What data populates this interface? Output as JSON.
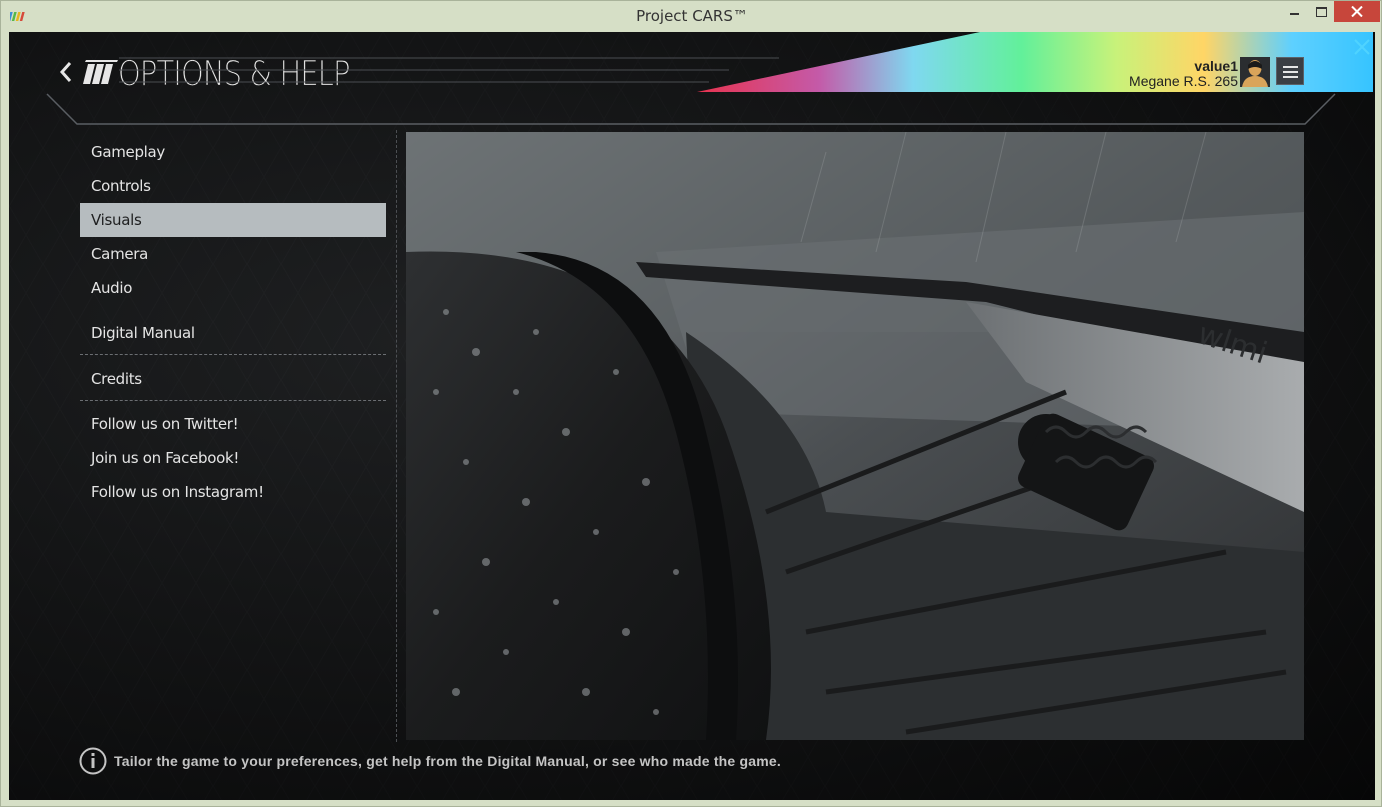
{
  "window": {
    "title": "Project CARS™"
  },
  "header": {
    "title": "OPTIONS & HELP",
    "profile_name": "value1",
    "profile_car": "Megane R.S. 265"
  },
  "sidebar": {
    "items": [
      {
        "label": "Gameplay",
        "active": false
      },
      {
        "label": "Controls",
        "active": false
      },
      {
        "label": "Visuals",
        "active": true
      },
      {
        "label": "Camera",
        "active": false
      },
      {
        "label": "Audio",
        "active": false
      },
      {
        "label": "Digital Manual",
        "active": false
      },
      {
        "label": "Credits",
        "active": false
      },
      {
        "label": "Follow us on Twitter!",
        "active": false
      },
      {
        "label": "Join us on Facebook!",
        "active": false
      },
      {
        "label": "Follow us on Instagram!",
        "active": false
      }
    ]
  },
  "hero": {
    "car_text": "wlmi"
  },
  "footer": {
    "info_text": "Tailor the game to your preferences, get help from the Digital Manual, or see who made the game."
  },
  "colors": {
    "active_item_bg": "#b6bcbf",
    "close_button": "#c7463b",
    "background": "#141516"
  }
}
